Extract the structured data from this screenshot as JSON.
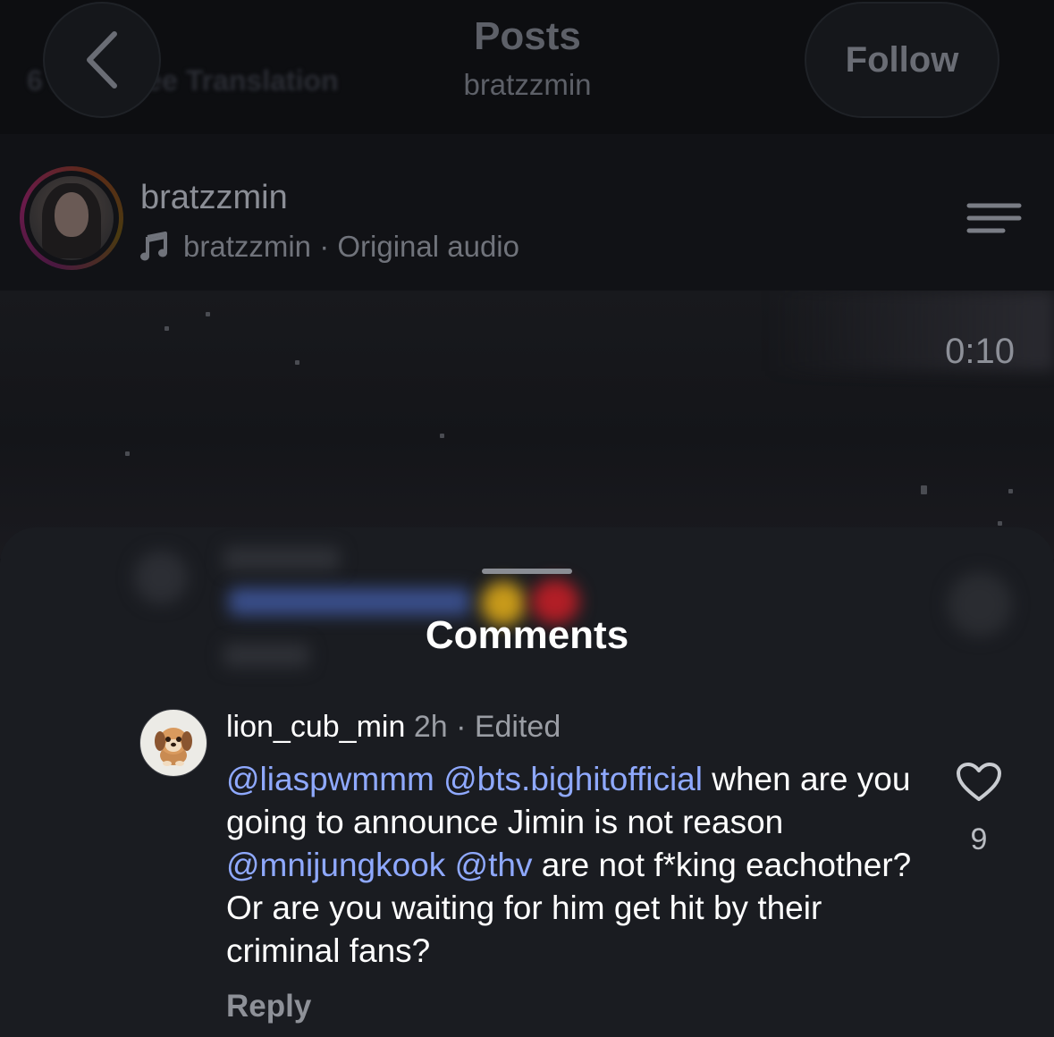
{
  "topbar": {
    "background_text": "6 ago · See Translation",
    "title": "Posts",
    "subtitle": "bratzzmin",
    "follow_label": "Follow"
  },
  "author": {
    "username": "bratzzmin",
    "audio_label": "bratzzmin · Original audio"
  },
  "video": {
    "time": "0:10"
  },
  "comments": {
    "title": "Comments",
    "comment": {
      "username": "lion_cub_min",
      "meta": "2h · Edited",
      "text_parts": [
        {
          "text": "@liaspwmmm",
          "type": "mention"
        },
        {
          "text": " ",
          "type": "text"
        },
        {
          "text": "@bts.bighitofficial",
          "type": "mention"
        },
        {
          "text": " when are you going to announce Jimin is not reason ",
          "type": "text"
        },
        {
          "text": "@mnijungkook",
          "type": "mention"
        },
        {
          "text": " ",
          "type": "text"
        },
        {
          "text": "@thv",
          "type": "mention"
        },
        {
          "text": " are not f*king eachother? Or are you waiting for him get hit by their  criminal fans?",
          "type": "text"
        }
      ],
      "reply_label": "Reply",
      "like_count": "9"
    }
  },
  "icons": {
    "back": "chevron-left-icon",
    "music": "music-note-icon",
    "menu": "menu-icon",
    "like": "heart-icon",
    "avatar": "puppy-avatar"
  },
  "colors": {
    "mention": "#8fa9ff",
    "sheet_bg": "#1a1c21",
    "page_bg": "#0b0c0f"
  }
}
